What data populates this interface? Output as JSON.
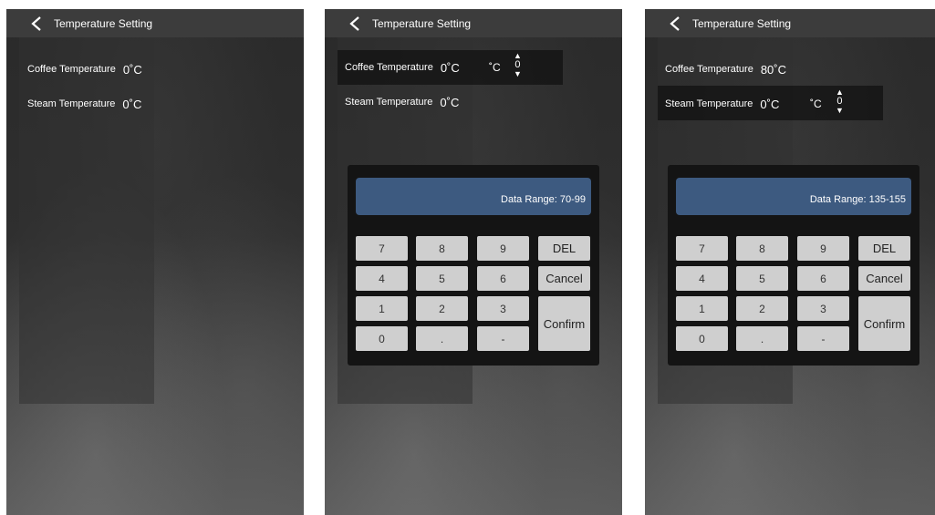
{
  "header": {
    "title": "Temperature Setting"
  },
  "labels": {
    "coffee": "Coffee Temperature",
    "steam": "Steam Temperature",
    "unit": "˚C"
  },
  "screens": [
    {
      "coffee_value": "0˚C",
      "steam_value": "0˚C"
    },
    {
      "coffee_value": "0˚C",
      "steam_value": "0˚C",
      "stepper_value": "0",
      "range": "Data Range: 70-99"
    },
    {
      "coffee_value": "80˚C",
      "steam_value": "0˚C",
      "stepper_value": "0",
      "range": "Data Range: 135-155"
    }
  ],
  "keypad": {
    "k7": "7",
    "k8": "8",
    "k9": "9",
    "del": "DEL",
    "k4": "4",
    "k5": "5",
    "k6": "6",
    "cancel": "Cancel",
    "k1": "1",
    "k2": "2",
    "k3": "3",
    "confirm": "Confirm",
    "k0": "0",
    "dot": ".",
    "minus": "-"
  },
  "colors": {
    "header": "#3c3c3c",
    "display": "#3d5a80",
    "key": "#cfcfcf",
    "keypad_bg": "#141414"
  },
  "icons": {
    "back": "chevron-left-icon",
    "up": "triangle-up-icon",
    "down": "triangle-down-icon"
  }
}
